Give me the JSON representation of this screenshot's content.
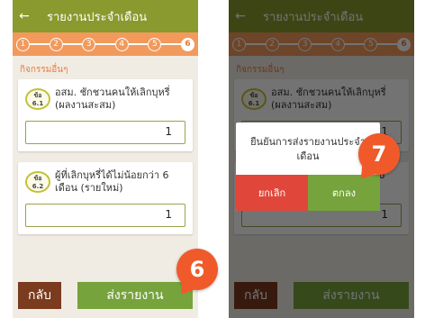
{
  "header": {
    "back_icon": "←",
    "title": "รายงานประจำเดือน"
  },
  "steps": [
    "1",
    "2",
    "3",
    "4",
    "5",
    "6"
  ],
  "active_step": "6",
  "section_title": "กิจกรรมอื่นๆ",
  "questions": [
    {
      "badge_top": "ข้อ",
      "badge_num": "6.1",
      "text": "อสม. ชักชวนคนให้เลิกบุหรี่ (ผลงานสะสม)",
      "value": "1"
    },
    {
      "badge_top": "ข้อ",
      "badge_num": "6.2",
      "text": "ผู้ที่เลิกบุหรี่ได้ไม่น้อยกว่า 6 เดือน (รายใหม่)",
      "value": "1"
    }
  ],
  "footer": {
    "back_label": "กลับ",
    "submit_label": "ส่งรายงาน"
  },
  "dialog": {
    "message": "ยืนยันการส่งรายงานประจำเดือน",
    "cancel_label": "ยกเลิก",
    "ok_label": "ตกลง"
  },
  "callouts": {
    "submit": "6",
    "confirm": "7"
  },
  "colors": {
    "header": "#8a9a2e",
    "steps": "#f29a5c",
    "accent": "#f07a3c",
    "submit": "#76a33c",
    "back": "#7a3b1e",
    "cancel": "#e0473a",
    "callout": "#f05a2a"
  }
}
